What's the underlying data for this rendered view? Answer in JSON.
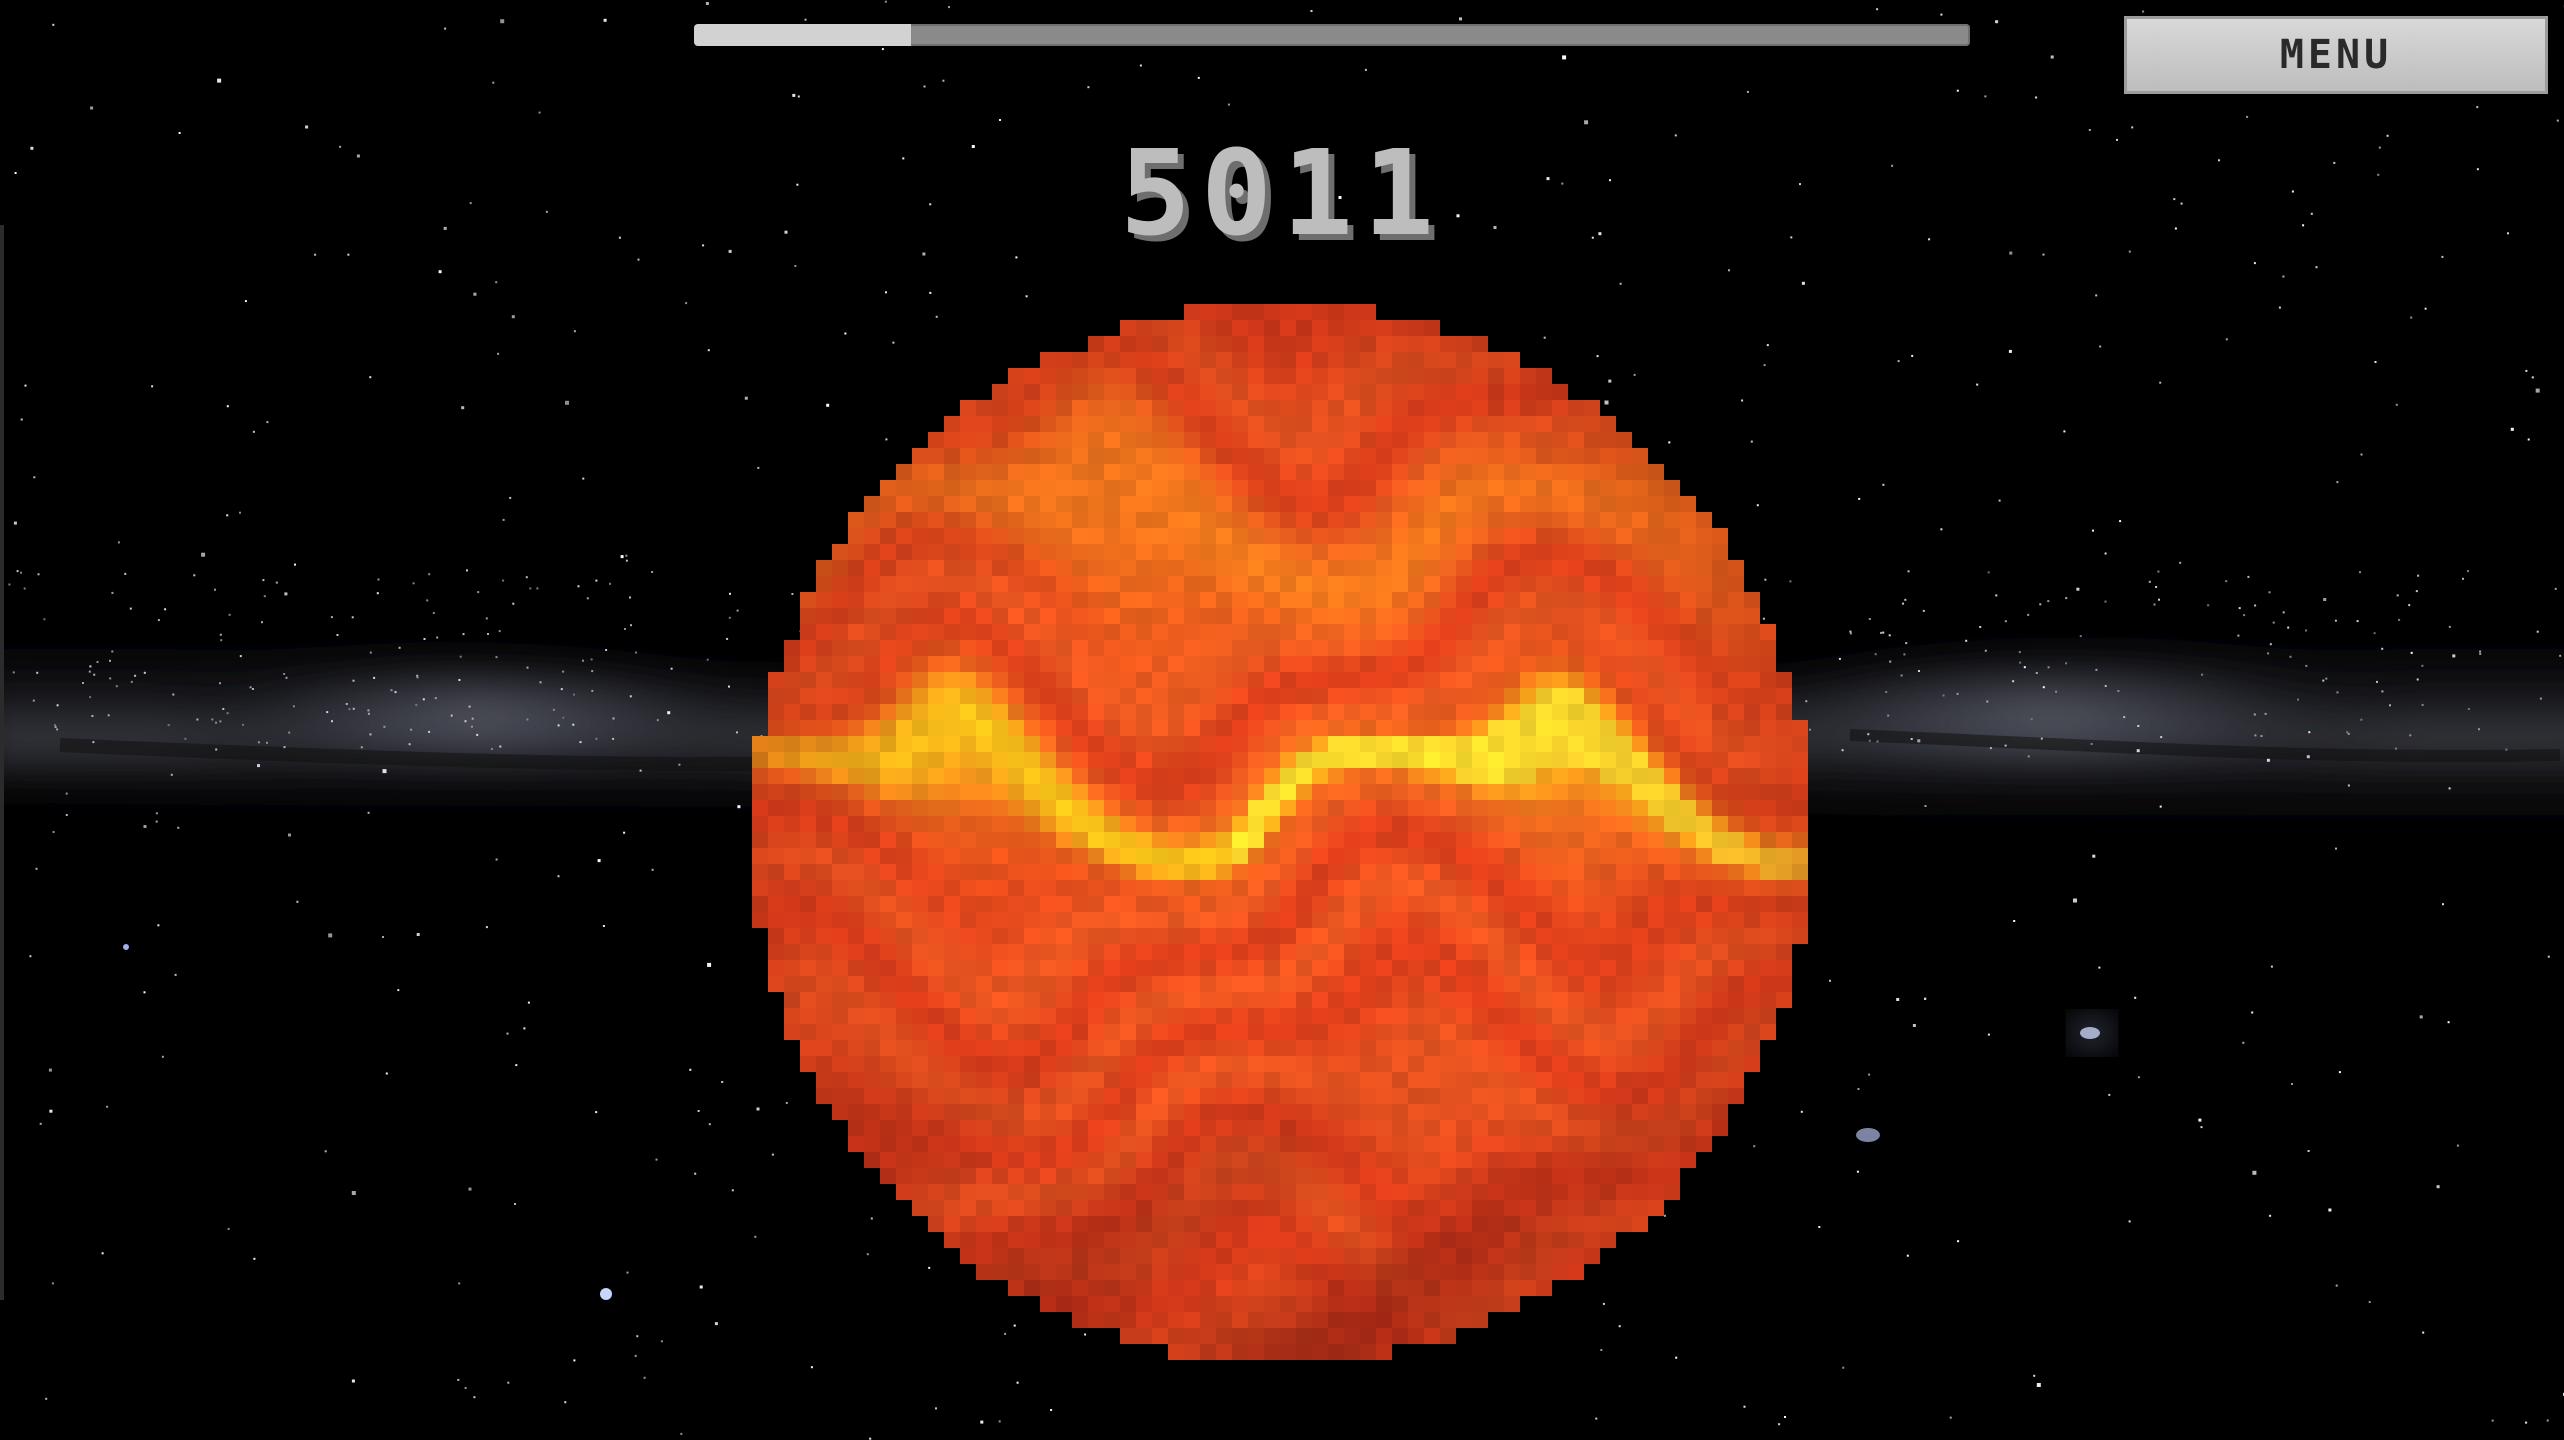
{
  "game": {
    "score": "5011",
    "menu_label": "MENU",
    "progress": 0.17,
    "planet": {
      "name_icon": "lava-gas-giant-planet",
      "colors": {
        "base": "#e2401c",
        "dark": "#8a1d12",
        "mid": "#f05a22",
        "orange": "#ff8a1e",
        "yellow": "#ffd21a",
        "bright": "#fff13a"
      }
    },
    "background": {
      "type": "starfield-milky-way",
      "colors": {
        "space": "#000000",
        "milky_way": "#4a4c5a",
        "star": "#ffffff"
      }
    }
  }
}
